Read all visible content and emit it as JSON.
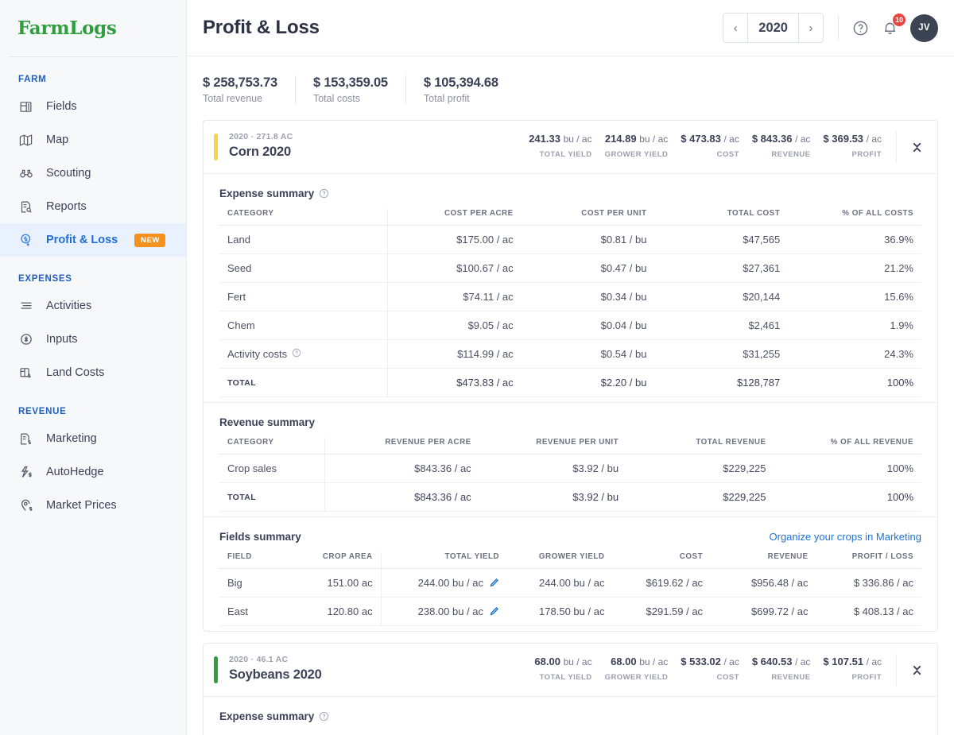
{
  "brand": {
    "logo_text": "FarmLogs",
    "logo_color": "#2e9e3e"
  },
  "sidebar": {
    "groups": [
      {
        "title": "FARM",
        "items": [
          {
            "label": "Fields",
            "icon": "fields-icon"
          },
          {
            "label": "Map",
            "icon": "map-icon"
          },
          {
            "label": "Scouting",
            "icon": "binoculars-icon"
          },
          {
            "label": "Reports",
            "icon": "report-icon"
          },
          {
            "label": "Profit & Loss",
            "icon": "profit-loss-icon",
            "active": true,
            "badge": "NEW"
          }
        ]
      },
      {
        "title": "EXPENSES",
        "items": [
          {
            "label": "Activities",
            "icon": "activities-icon"
          },
          {
            "label": "Inputs",
            "icon": "inputs-icon"
          },
          {
            "label": "Land Costs",
            "icon": "land-costs-icon"
          }
        ]
      },
      {
        "title": "REVENUE",
        "items": [
          {
            "label": "Marketing",
            "icon": "marketing-icon"
          },
          {
            "label": "AutoHedge",
            "icon": "autohedge-icon"
          },
          {
            "label": "Market Prices",
            "icon": "market-prices-icon"
          }
        ]
      }
    ]
  },
  "header": {
    "title": "Profit & Loss",
    "year": "2020",
    "prev_label": "‹",
    "next_label": "›",
    "help_icon": "help-circle-icon",
    "notifications_icon": "bell-icon",
    "notifications_count": "10",
    "avatar_initials": "JV"
  },
  "summary": [
    {
      "value": "$ 258,753.73",
      "label": "Total revenue"
    },
    {
      "value": "$ 153,359.05",
      "label": "Total costs"
    },
    {
      "value": "$ 105,394.68",
      "label": "Total profit"
    }
  ],
  "crops": [
    {
      "meta": "2020 · 271.8 AC",
      "name": "Corn 2020",
      "accent": "#fbd14b",
      "metrics": [
        {
          "value": "241.33",
          "unit": "bu / ac",
          "label": "TOTAL YIELD"
        },
        {
          "value": "214.89",
          "unit": "bu / ac",
          "label": "GROWER YIELD"
        },
        {
          "value": "$ 473.83",
          "unit": "/ ac",
          "label": "COST"
        },
        {
          "value": "$ 843.36",
          "unit": "/ ac",
          "label": "REVENUE"
        },
        {
          "value": "$ 369.53",
          "unit": "/ ac",
          "label": "PROFIT"
        }
      ],
      "expense_summary": {
        "title": "Expense summary",
        "columns": [
          "CATEGORY",
          "COST PER ACRE",
          "COST PER UNIT",
          "TOTAL COST",
          "% OF ALL COSTS"
        ],
        "rows": [
          {
            "category": "Land",
            "per_acre": "$175.00 / ac",
            "per_unit": "$0.81 / bu",
            "total": "$47,565",
            "pct": "36.9%"
          },
          {
            "category": "Seed",
            "per_acre": "$100.67 / ac",
            "per_unit": "$0.47 / bu",
            "total": "$27,361",
            "pct": "21.2%"
          },
          {
            "category": "Fert",
            "per_acre": "$74.11 / ac",
            "per_unit": "$0.34 / bu",
            "total": "$20,144",
            "pct": "15.6%"
          },
          {
            "category": "Chem",
            "per_acre": "$9.05 / ac",
            "per_unit": "$0.04 / bu",
            "total": "$2,461",
            "pct": "1.9%"
          },
          {
            "category": "Activity costs",
            "per_acre": "$114.99 / ac",
            "per_unit": "$0.54 / bu",
            "total": "$31,255",
            "pct": "24.3%",
            "info": true
          }
        ],
        "total_row": {
          "category": "TOTAL",
          "per_acre": "$473.83 / ac",
          "per_unit": "$2.20 / bu",
          "total": "$128,787",
          "pct": "100%"
        }
      },
      "revenue_summary": {
        "title": "Revenue summary",
        "columns": [
          "CATEGORY",
          "REVENUE PER ACRE",
          "REVENUE PER UNIT",
          "TOTAL REVENUE",
          "% OF ALL REVENUE"
        ],
        "rows": [
          {
            "category": "Crop sales",
            "link": true,
            "per_acre": "$843.36 / ac",
            "per_unit": "$3.92 / bu",
            "total": "$229,225",
            "pct": "100%"
          }
        ],
        "total_row": {
          "category": "TOTAL",
          "per_acre": "$843.36 / ac",
          "per_unit": "$3.92 / bu",
          "total": "$229,225",
          "pct": "100%"
        }
      },
      "fields_summary": {
        "title": "Fields summary",
        "link": "Organize your crops in Marketing",
        "columns": [
          "FIELD",
          "CROP AREA",
          "TOTAL YIELD",
          "GROWER YIELD",
          "COST",
          "REVENUE",
          "PROFIT / LOSS"
        ],
        "rows": [
          {
            "field": "Big",
            "crop_area": "151.00 ac",
            "total_yield": "244.00 bu / ac",
            "editable": true,
            "grower_yield": "244.00 bu / ac",
            "cost": "$619.62 / ac",
            "revenue": "$956.48 / ac",
            "profit": "$ 336.86 / ac"
          },
          {
            "field": "East",
            "crop_area": "120.80 ac",
            "total_yield": "238.00 bu / ac",
            "editable": true,
            "grower_yield": "178.50 bu / ac",
            "cost": "$291.59 / ac",
            "revenue": "$699.72 / ac",
            "profit": "$ 408.13 / ac"
          }
        ]
      }
    },
    {
      "meta": "2020 · 46.1 AC",
      "name": "Soybeans 2020",
      "accent": "#2e9e3e",
      "metrics": [
        {
          "value": "68.00",
          "unit": "bu / ac",
          "label": "TOTAL YIELD"
        },
        {
          "value": "68.00",
          "unit": "bu / ac",
          "label": "GROWER YIELD"
        },
        {
          "value": "$ 533.02",
          "unit": "/ ac",
          "label": "COST"
        },
        {
          "value": "$ 640.53",
          "unit": "/ ac",
          "label": "REVENUE"
        },
        {
          "value": "$ 107.51",
          "unit": "/ ac",
          "label": "PROFIT"
        }
      ],
      "expense_summary": {
        "title": "Expense summary"
      }
    }
  ]
}
